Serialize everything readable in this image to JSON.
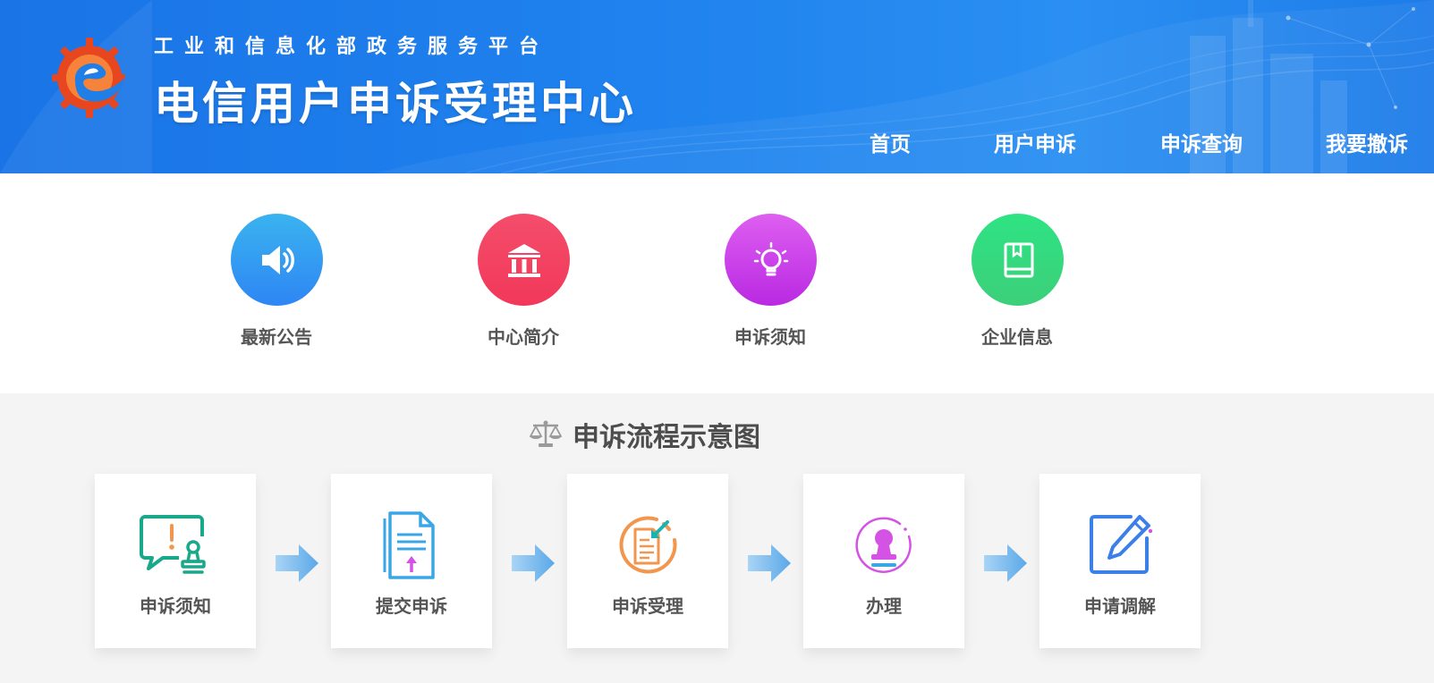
{
  "header": {
    "subtitle": "工业和信息化部政务服务平台",
    "title": "电信用户申诉受理中心",
    "nav": [
      {
        "label": "首页"
      },
      {
        "label": "用户申诉"
      },
      {
        "label": "申诉查询"
      },
      {
        "label": "我要撤诉"
      }
    ]
  },
  "quick_links": [
    {
      "label": "最新公告",
      "icon": "speaker-icon",
      "color_top": "#3ab3ef",
      "color_bottom": "#2e86f4"
    },
    {
      "label": "中心简介",
      "icon": "building-icon",
      "color_top": "#f44d6b",
      "color_bottom": "#f2385a"
    },
    {
      "label": "申诉须知",
      "icon": "lightbulb-icon",
      "color_top": "#de5ff1",
      "color_bottom": "#b929e2"
    },
    {
      "label": "企业信息",
      "icon": "book-icon",
      "color_top": "#2ee383",
      "color_bottom": "#3ccf7a"
    }
  ],
  "process": {
    "title": "申诉流程示意图",
    "steps": [
      {
        "label": "申诉须知",
        "icon": "notice-chat-icon",
        "color": "#19a98a"
      },
      {
        "label": "提交申诉",
        "icon": "document-upload-icon",
        "color": "#3ba6e6"
      },
      {
        "label": "申诉受理",
        "icon": "document-accept-icon",
        "color": "#f2954d"
      },
      {
        "label": "办理",
        "icon": "stamp-icon",
        "color": "#d452e4"
      },
      {
        "label": "申请调解",
        "icon": "edit-icon",
        "color": "#3b7fe9"
      }
    ]
  }
}
